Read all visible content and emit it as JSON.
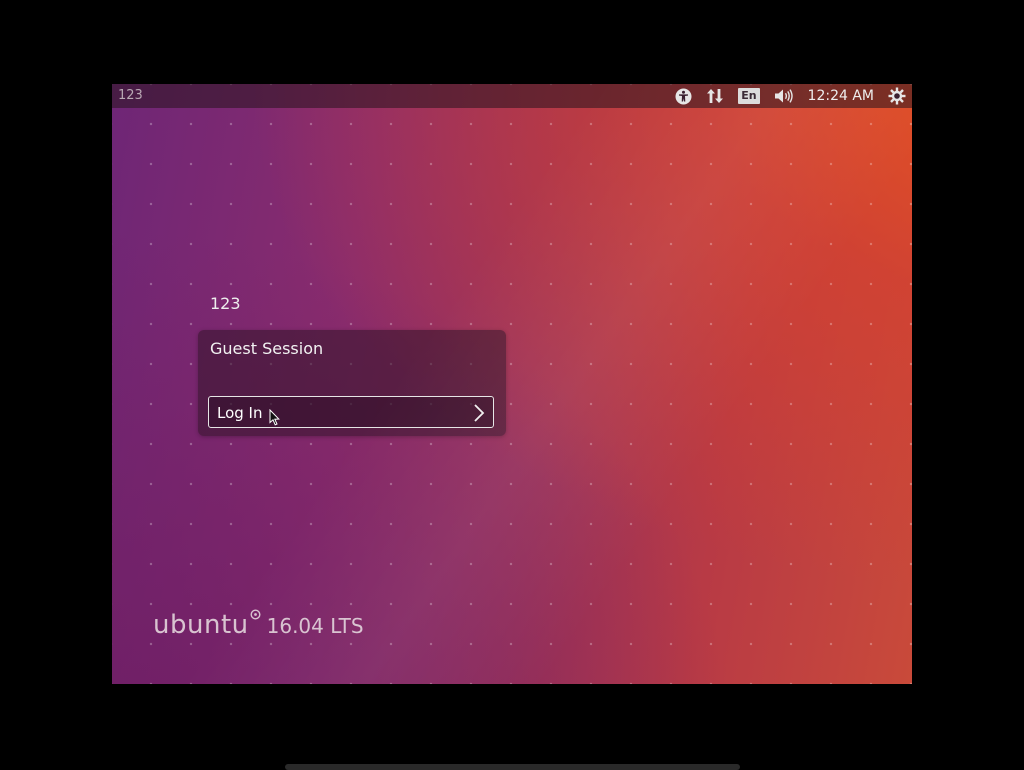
{
  "top_panel": {
    "hostname": "123",
    "indicators": {
      "accessibility_icon": "accessibility-icon",
      "network_icon": "network-updown-icon",
      "keyboard_layout": "En",
      "sound_icon": "speaker-volume-icon",
      "clock": "12:24 AM",
      "power_icon": "gear-power-icon"
    }
  },
  "greeter": {
    "user_name": "123",
    "session_name": "Guest Session",
    "login_label": "Log In"
  },
  "branding": {
    "word": "ubuntu",
    "version": "16.04 LTS"
  },
  "colors": {
    "accent_orange": "#e95420",
    "aubergine": "#772953"
  }
}
